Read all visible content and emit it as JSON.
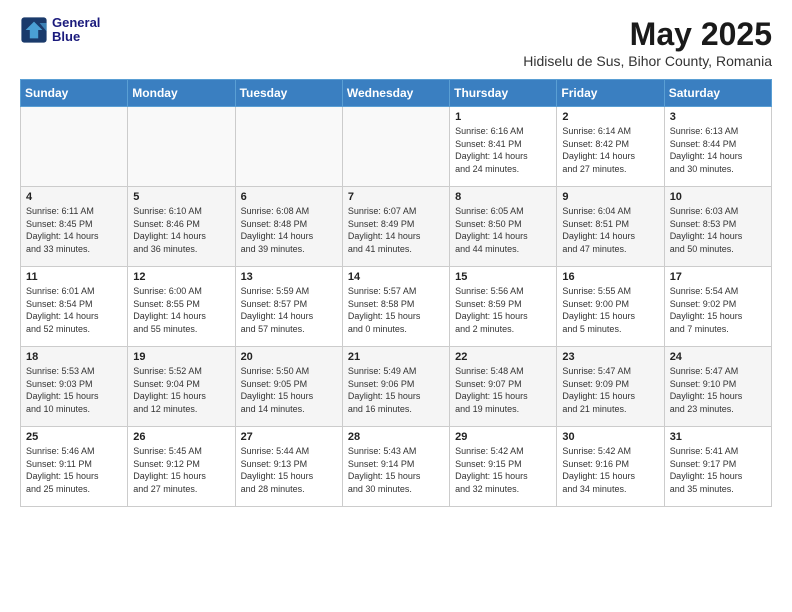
{
  "header": {
    "logo_line1": "General",
    "logo_line2": "Blue",
    "month_title": "May 2025",
    "subtitle": "Hidiselu de Sus, Bihor County, Romania"
  },
  "days_of_week": [
    "Sunday",
    "Monday",
    "Tuesday",
    "Wednesday",
    "Thursday",
    "Friday",
    "Saturday"
  ],
  "weeks": [
    [
      {
        "day": "",
        "info": ""
      },
      {
        "day": "",
        "info": ""
      },
      {
        "day": "",
        "info": ""
      },
      {
        "day": "",
        "info": ""
      },
      {
        "day": "1",
        "info": "Sunrise: 6:16 AM\nSunset: 8:41 PM\nDaylight: 14 hours\nand 24 minutes."
      },
      {
        "day": "2",
        "info": "Sunrise: 6:14 AM\nSunset: 8:42 PM\nDaylight: 14 hours\nand 27 minutes."
      },
      {
        "day": "3",
        "info": "Sunrise: 6:13 AM\nSunset: 8:44 PM\nDaylight: 14 hours\nand 30 minutes."
      }
    ],
    [
      {
        "day": "4",
        "info": "Sunrise: 6:11 AM\nSunset: 8:45 PM\nDaylight: 14 hours\nand 33 minutes."
      },
      {
        "day": "5",
        "info": "Sunrise: 6:10 AM\nSunset: 8:46 PM\nDaylight: 14 hours\nand 36 minutes."
      },
      {
        "day": "6",
        "info": "Sunrise: 6:08 AM\nSunset: 8:48 PM\nDaylight: 14 hours\nand 39 minutes."
      },
      {
        "day": "7",
        "info": "Sunrise: 6:07 AM\nSunset: 8:49 PM\nDaylight: 14 hours\nand 41 minutes."
      },
      {
        "day": "8",
        "info": "Sunrise: 6:05 AM\nSunset: 8:50 PM\nDaylight: 14 hours\nand 44 minutes."
      },
      {
        "day": "9",
        "info": "Sunrise: 6:04 AM\nSunset: 8:51 PM\nDaylight: 14 hours\nand 47 minutes."
      },
      {
        "day": "10",
        "info": "Sunrise: 6:03 AM\nSunset: 8:53 PM\nDaylight: 14 hours\nand 50 minutes."
      }
    ],
    [
      {
        "day": "11",
        "info": "Sunrise: 6:01 AM\nSunset: 8:54 PM\nDaylight: 14 hours\nand 52 minutes."
      },
      {
        "day": "12",
        "info": "Sunrise: 6:00 AM\nSunset: 8:55 PM\nDaylight: 14 hours\nand 55 minutes."
      },
      {
        "day": "13",
        "info": "Sunrise: 5:59 AM\nSunset: 8:57 PM\nDaylight: 14 hours\nand 57 minutes."
      },
      {
        "day": "14",
        "info": "Sunrise: 5:57 AM\nSunset: 8:58 PM\nDaylight: 15 hours\nand 0 minutes."
      },
      {
        "day": "15",
        "info": "Sunrise: 5:56 AM\nSunset: 8:59 PM\nDaylight: 15 hours\nand 2 minutes."
      },
      {
        "day": "16",
        "info": "Sunrise: 5:55 AM\nSunset: 9:00 PM\nDaylight: 15 hours\nand 5 minutes."
      },
      {
        "day": "17",
        "info": "Sunrise: 5:54 AM\nSunset: 9:02 PM\nDaylight: 15 hours\nand 7 minutes."
      }
    ],
    [
      {
        "day": "18",
        "info": "Sunrise: 5:53 AM\nSunset: 9:03 PM\nDaylight: 15 hours\nand 10 minutes."
      },
      {
        "day": "19",
        "info": "Sunrise: 5:52 AM\nSunset: 9:04 PM\nDaylight: 15 hours\nand 12 minutes."
      },
      {
        "day": "20",
        "info": "Sunrise: 5:50 AM\nSunset: 9:05 PM\nDaylight: 15 hours\nand 14 minutes."
      },
      {
        "day": "21",
        "info": "Sunrise: 5:49 AM\nSunset: 9:06 PM\nDaylight: 15 hours\nand 16 minutes."
      },
      {
        "day": "22",
        "info": "Sunrise: 5:48 AM\nSunset: 9:07 PM\nDaylight: 15 hours\nand 19 minutes."
      },
      {
        "day": "23",
        "info": "Sunrise: 5:47 AM\nSunset: 9:09 PM\nDaylight: 15 hours\nand 21 minutes."
      },
      {
        "day": "24",
        "info": "Sunrise: 5:47 AM\nSunset: 9:10 PM\nDaylight: 15 hours\nand 23 minutes."
      }
    ],
    [
      {
        "day": "25",
        "info": "Sunrise: 5:46 AM\nSunset: 9:11 PM\nDaylight: 15 hours\nand 25 minutes."
      },
      {
        "day": "26",
        "info": "Sunrise: 5:45 AM\nSunset: 9:12 PM\nDaylight: 15 hours\nand 27 minutes."
      },
      {
        "day": "27",
        "info": "Sunrise: 5:44 AM\nSunset: 9:13 PM\nDaylight: 15 hours\nand 28 minutes."
      },
      {
        "day": "28",
        "info": "Sunrise: 5:43 AM\nSunset: 9:14 PM\nDaylight: 15 hours\nand 30 minutes."
      },
      {
        "day": "29",
        "info": "Sunrise: 5:42 AM\nSunset: 9:15 PM\nDaylight: 15 hours\nand 32 minutes."
      },
      {
        "day": "30",
        "info": "Sunrise: 5:42 AM\nSunset: 9:16 PM\nDaylight: 15 hours\nand 34 minutes."
      },
      {
        "day": "31",
        "info": "Sunrise: 5:41 AM\nSunset: 9:17 PM\nDaylight: 15 hours\nand 35 minutes."
      }
    ]
  ]
}
